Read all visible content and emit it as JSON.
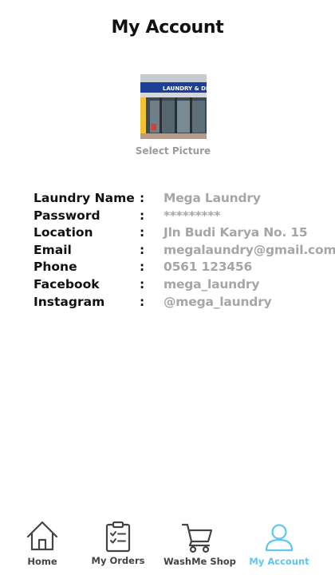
{
  "header": {
    "title": "My Account"
  },
  "profile": {
    "picture_label": "Select Picture",
    "store_sign": "LAUNDRY & DRY CLEA"
  },
  "details": [
    {
      "label": "Laundry Name",
      "value": "Mega Laundry"
    },
    {
      "label": "Password",
      "value": "*********"
    },
    {
      "label": "Location",
      "value": "Jln Budi Karya No. 15"
    },
    {
      "label": "Email",
      "value": "megalaundry@gmail.com"
    },
    {
      "label": "Phone",
      "value": "0561 123456"
    },
    {
      "label": "Facebook",
      "value": "mega_laundry"
    },
    {
      "label": "Instagram",
      "value": "@mega_laundry"
    }
  ],
  "separator": ":",
  "nav": {
    "items": [
      {
        "label": "Home",
        "icon": "home-icon"
      },
      {
        "label": "My Orders",
        "icon": "clipboard-checklist-icon"
      },
      {
        "label": "WashMe Shop",
        "icon": "shopping-cart-icon"
      },
      {
        "label": "My Account",
        "icon": "user-icon"
      }
    ],
    "active": "My Account",
    "colors": {
      "active": "#5ec6ef",
      "inactive": "#444444"
    }
  }
}
